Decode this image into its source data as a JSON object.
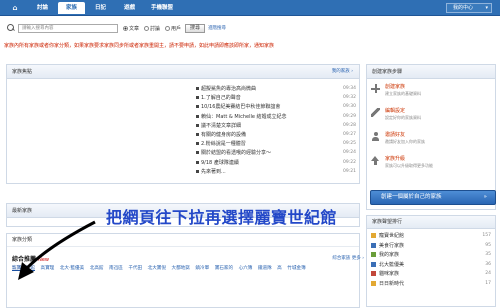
{
  "nav": {
    "home_icon": "home-icon",
    "tabs": [
      "討論",
      "家族",
      "日記",
      "遊戲",
      "手機聯盟"
    ],
    "active_tab": "家族",
    "my_page_label": "我的中心",
    "my_page_arrow": "▾"
  },
  "search": {
    "placeholder": "請輸入搜尋內容",
    "options": [
      "文章",
      "討論",
      "用戶"
    ],
    "selected_option": "文章",
    "button_label": "搜尋",
    "advanced_label": "進階搜尋"
  },
  "notice": "家族內所有家族或者你家分類，如果家族要求家族同步所或者家族重開主，請不要申請，如此申請即應該即所家，通知家族",
  "family_news": {
    "title": "家族焦點",
    "more": "我的家族 ›",
    "items": [
      {
        "text": "超擬鯊魚的專治高尚微曲",
        "time": "09:34"
      },
      {
        "text": "1.了解自己的聲音",
        "time": "09:32"
      },
      {
        "text": "10/16農紀美賽結巴中秋佳節聯誼會",
        "time": "09:30"
      },
      {
        "text": "賴仙：Matt & Michelle 結婚成立紀念",
        "time": "09:29"
      },
      {
        "text": "議不清楚文章詳細",
        "time": "09:28"
      },
      {
        "text": "有關的健身房的設備",
        "time": "09:27"
      },
      {
        "text": "2.粉絲說是一種體習",
        "time": "09:25"
      },
      {
        "text": "關於結盟的看透哦的經驗分享～",
        "time": "09:24"
      },
      {
        "text": "9/18 產球隊連續",
        "time": "09:22"
      },
      {
        "text": "先來著到...",
        "time": "09:21"
      }
    ]
  },
  "latest_family": {
    "title": "最新家族"
  },
  "create_panel": {
    "title": "創建家族步驟",
    "steps": [
      {
        "icon": "plus-icon",
        "title": "創建家族",
        "desc": "建立家族的基礎資料"
      },
      {
        "icon": "pencil-icon",
        "title": "編輯設定",
        "desc": "設定好你的家族資料"
      },
      {
        "icon": "person-icon",
        "title": "邀請好友",
        "desc": "邀請好友加入你的家族"
      },
      {
        "icon": "upgrade-icon",
        "title": "家族升級",
        "desc": "家族可以升級取得更多功能"
      }
    ],
    "button_label": "創建一個屬於自己的家族",
    "button_arrow": "»"
  },
  "rank": {
    "title": "家族聲望排行",
    "items": [
      {
        "name": "寵寶世紀館",
        "count": "157"
      },
      {
        "name": "美食行家族",
        "count": "95"
      },
      {
        "name": "我的家族",
        "count": "35"
      },
      {
        "name": "北大籃優美",
        "count": "36"
      },
      {
        "name": "貓咪家族",
        "count": "24"
      },
      {
        "name": "日日新時代",
        "count": "17"
      }
    ]
  },
  "categories": {
    "title": "家族分類",
    "label": "綜合推薦",
    "hot": "New",
    "more": "綜合家族 更多 ›",
    "items": [
      "寵寶世紀館",
      "高寶理",
      "北大·籃優美",
      "北高館",
      "南迅區",
      "千代田",
      "北大寶倪",
      "大都地獄",
      "鎮冷軍",
      "寶石家的",
      "心六簿",
      "鐵道隊",
      "高",
      "竹城金簿"
    ]
  },
  "overlay_text": "把網頁往下拉再選擇麗寶世紀館"
}
